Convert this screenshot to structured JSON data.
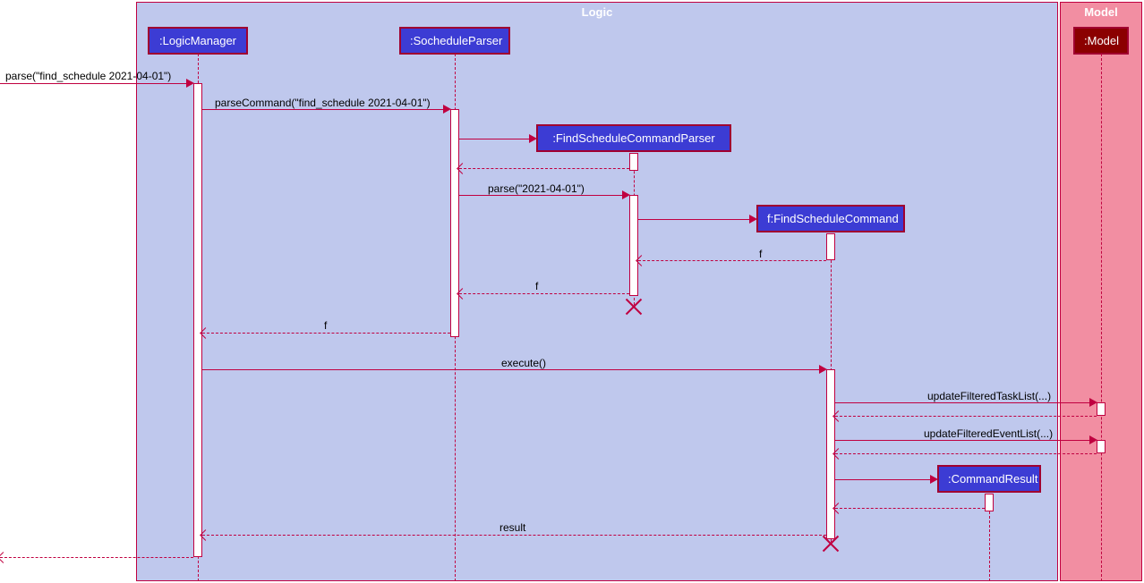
{
  "partitions": {
    "logic": "Logic",
    "model": "Model"
  },
  "participants": {
    "logicManager": ":LogicManager",
    "socheduleParser": ":SocheduleParser",
    "findScheduleCommandParser": ":FindScheduleCommandParser",
    "findScheduleCommand": "f:FindScheduleCommand",
    "commandResult": ":CommandResult",
    "model": ":Model"
  },
  "messages": {
    "entry": "parse(\"find_schedule 2021-04-01\")",
    "parseCommand": "parseCommand(\"find_schedule 2021-04-01\")",
    "parseDate": "parse(\"2021-04-01\")",
    "returnF1": "f",
    "returnF2": "f",
    "returnF3": "f",
    "execute": "execute()",
    "updateTask": "updateFilteredTaskList(...)",
    "updateEvent": "updateFilteredEventList(...)",
    "result": "result"
  }
}
